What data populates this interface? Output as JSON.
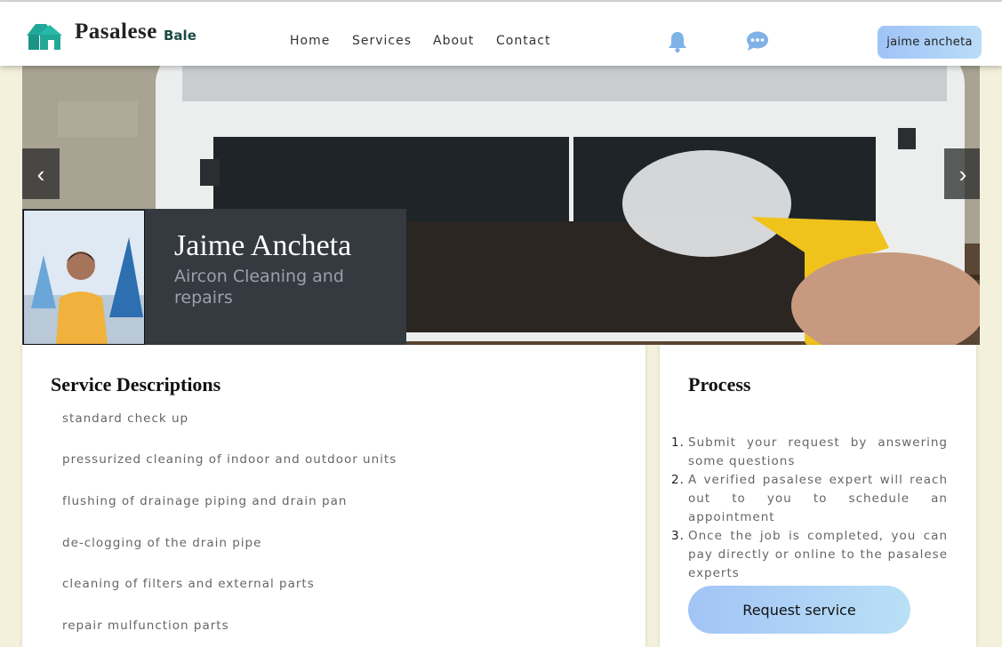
{
  "brand": {
    "name": "Pasalese",
    "sub": "Bale",
    "logo_icon": "house-logo-icon",
    "accent": "#1fa89a"
  },
  "nav": {
    "links": [
      "Home",
      "Services",
      "About",
      "Contact"
    ],
    "bell_icon": "bell-icon",
    "chat_icon": "chat-icon",
    "user_label": "jaime ancheta"
  },
  "carousel": {
    "prev": "‹",
    "next": "›"
  },
  "profile": {
    "name": "Jaime Ancheta",
    "service": "Aircon Cleaning and repairs"
  },
  "descriptions": {
    "title": "Service Descriptions",
    "items": [
      "standard check up",
      "pressurized cleaning of indoor and outdoor units",
      "flushing of drainage piping and drain pan",
      "de-clogging of the drain pipe",
      "cleaning of filters and external parts",
      "repair mulfunction parts"
    ]
  },
  "process": {
    "title": "Process",
    "steps": [
      "Submit your request by answering some questions",
      "A verified pasalese expert will reach out to you to schedule an appointment",
      "Once the job is completed, you can pay directly or online to the pasalese experts"
    ],
    "numbers": [
      "1.",
      "2.",
      "3."
    ],
    "button": "Request service"
  }
}
